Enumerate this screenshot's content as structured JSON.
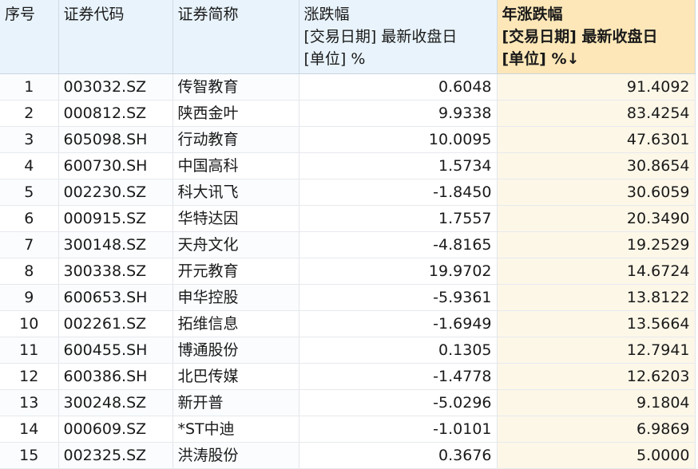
{
  "table": {
    "headers": {
      "index": "序号",
      "code": "证券代码",
      "name": "证券简称",
      "change": [
        "涨跌幅",
        "[交易日期] 最新收盘日",
        "[单位] %"
      ],
      "year_change": [
        "年涨跌幅",
        "[交易日期] 最新收盘日",
        "[单位] %↓"
      ]
    },
    "rows": [
      {
        "index": "1",
        "code": "003032.SZ",
        "name": "传智教育",
        "change": "0.6048",
        "year_change": "91.4092"
      },
      {
        "index": "2",
        "code": "000812.SZ",
        "name": "陕西金叶",
        "change": "9.9338",
        "year_change": "83.4254"
      },
      {
        "index": "3",
        "code": "605098.SH",
        "name": "行动教育",
        "change": "10.0095",
        "year_change": "47.6301"
      },
      {
        "index": "4",
        "code": "600730.SH",
        "name": "中国高科",
        "change": "1.5734",
        "year_change": "30.8654"
      },
      {
        "index": "5",
        "code": "002230.SZ",
        "name": "科大讯飞",
        "change": "-1.8450",
        "year_change": "30.6059"
      },
      {
        "index": "6",
        "code": "000915.SZ",
        "name": "华特达因",
        "change": "1.7557",
        "year_change": "20.3490"
      },
      {
        "index": "7",
        "code": "300148.SZ",
        "name": "天舟文化",
        "change": "-4.8165",
        "year_change": "19.2529"
      },
      {
        "index": "8",
        "code": "300338.SZ",
        "name": "开元教育",
        "change": "19.9702",
        "year_change": "14.6724"
      },
      {
        "index": "9",
        "code": "600653.SH",
        "name": "申华控股",
        "change": "-5.9361",
        "year_change": "13.8122"
      },
      {
        "index": "10",
        "code": "002261.SZ",
        "name": "拓维信息",
        "change": "-1.6949",
        "year_change": "13.5664"
      },
      {
        "index": "11",
        "code": "600455.SH",
        "name": "博通股份",
        "change": "0.1305",
        "year_change": "12.7941"
      },
      {
        "index": "12",
        "code": "600386.SH",
        "name": "北巴传媒",
        "change": "-1.4778",
        "year_change": "12.6203"
      },
      {
        "index": "13",
        "code": "300248.SZ",
        "name": "新开普",
        "change": "-5.0296",
        "year_change": "9.1804"
      },
      {
        "index": "14",
        "code": "000609.SZ",
        "name": "*ST中迪",
        "change": "-1.0101",
        "year_change": "6.9869"
      },
      {
        "index": "15",
        "code": "002325.SZ",
        "name": "洪涛股份",
        "change": "0.3676",
        "year_change": "5.0000"
      }
    ]
  }
}
